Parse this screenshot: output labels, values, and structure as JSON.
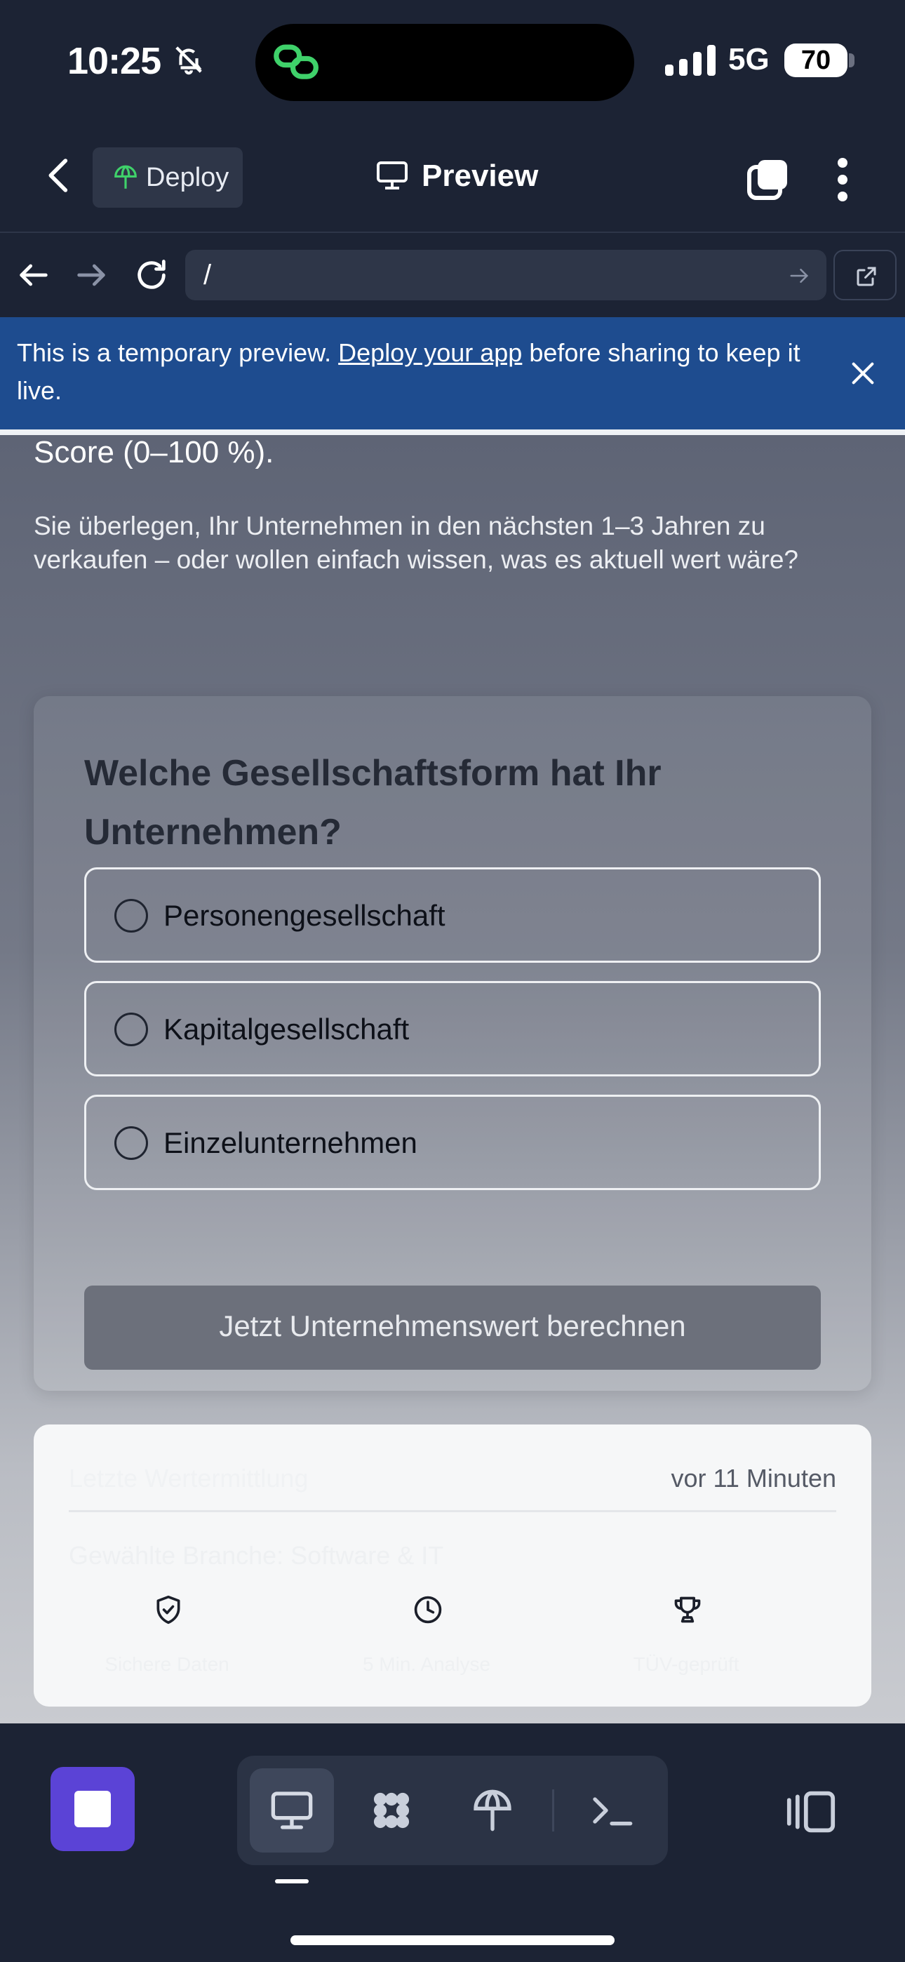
{
  "status_bar": {
    "time": "10:25",
    "network": "5G",
    "battery": "70"
  },
  "header": {
    "deploy_label": "Deploy",
    "title": "Preview"
  },
  "browser": {
    "url": "/"
  },
  "banner": {
    "text_before": "This is a temporary preview. ",
    "link_text": "Deploy your app",
    "text_after": " before sharing to keep it live."
  },
  "page": {
    "score_text": "Score (0–100 %).",
    "intro": "Sie überlegen, Ihr Unternehmen in den nächsten 1–3 Jahren zu verkaufen – oder wollen einfach wissen, was es aktuell wert wäre?",
    "question": "Welche Gesellschaftsform hat Ihr Unternehmen?",
    "options": [
      "Personengesellschaft",
      "Kapitalgesellschaft",
      "Einzelunternehmen"
    ],
    "submit_label": "Jetzt Unternehmenswert berechnen"
  },
  "info_card": {
    "last_valuation_label": "Letzte Wertermittlung",
    "last_valuation_time": "vor 11 Minuten",
    "branch_text": "Gewählte Branche: Software & IT",
    "badges": [
      {
        "icon": "shield-check-icon",
        "label": "Sichere Daten"
      },
      {
        "icon": "clock-icon",
        "label": "5 Min. Analyse"
      },
      {
        "icon": "trophy-icon",
        "label": "TÜV-geprüft"
      }
    ]
  },
  "colors": {
    "background": "#1c2334",
    "banner": "#1e4c8f",
    "accent": "#5b43d6"
  }
}
